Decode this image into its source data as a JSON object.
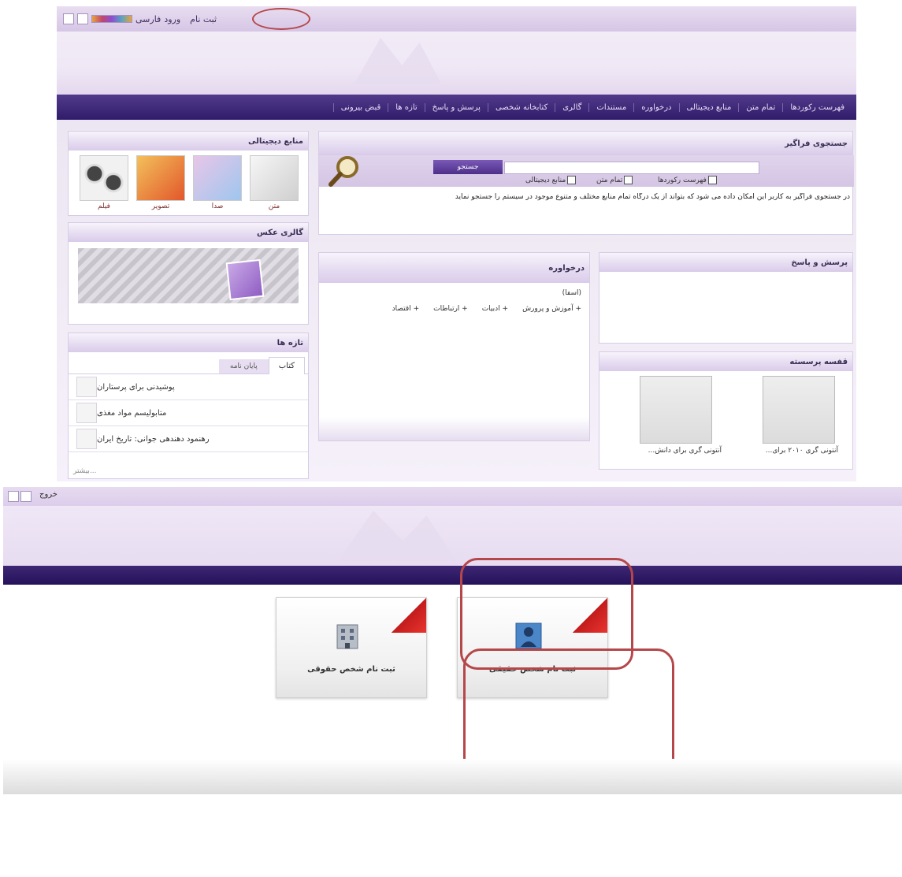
{
  "shot1": {
    "topbar": {
      "register": "ثبت نام",
      "login": "ورود",
      "language": "فارسی"
    },
    "nav_items": [
      "فهرست رکوردها",
      "تمام متن",
      "منابع دیجیتالی",
      "درخواوره",
      "مستندات",
      "گالری",
      "کتابخانه شخصی",
      "پرسش و پاسخ",
      "تازه ها",
      "قبض بیرونی"
    ],
    "search": {
      "title": "جستجوی فراگیر",
      "button": "جستجو",
      "options": [
        "فهرست رکوردها",
        "تمام متن",
        "منابع دیجیتالی"
      ],
      "description": "در جستجوی فراگیر به کاربر این امکان داده می شود که بتواند از یک درگاه تمام منابع مختلف و متنوع موجود در سیستم را جستجو نماید"
    },
    "resources": {
      "title": "منابع دیجیتالی",
      "items": [
        {
          "label": "متن",
          "icon": "document-icon"
        },
        {
          "label": "صدا",
          "icon": "music-icon"
        },
        {
          "label": "تصویر",
          "icon": "image-icon"
        },
        {
          "label": "فیلم",
          "icon": "film-icon"
        }
      ]
    },
    "gallery": {
      "title": "گالری عکس"
    },
    "news": {
      "title": "تازه ها",
      "tabs": [
        "کتاب",
        "پایان نامه"
      ],
      "items": [
        "پوشیدنی برای پرستاران",
        "متابولیسم مواد مغذی",
        "رهنمود دهندهی جوانی: تاریخ ایران"
      ],
      "more": "بیشتر..."
    },
    "requests": {
      "title": "درخواوره",
      "sub": "(اسفا)",
      "categories": [
        "آموزش و پرورش",
        "ادبیات",
        "ارتباطات",
        "اقتصاد"
      ]
    },
    "qa": {
      "title": "پرسش و پاسخ"
    },
    "showcase": {
      "title": "قفسه پرسسته",
      "items": [
        "آنتونی گری ۲۰۱۰ برای...",
        "آنتونی گری برای دانش..."
      ]
    }
  },
  "shot2": {
    "topbar": "خروج",
    "cards": [
      {
        "label": "ثبت نام شخص حقوقی",
        "icon": "building-icon"
      },
      {
        "label": "ثبت نام شخص حقیقی",
        "icon": "person-icon"
      }
    ]
  },
  "colors": {
    "nav": "#3a2473",
    "accent": "#7a59b6",
    "highlight": "#b5474a",
    "ribbon": "#c31c1c"
  }
}
